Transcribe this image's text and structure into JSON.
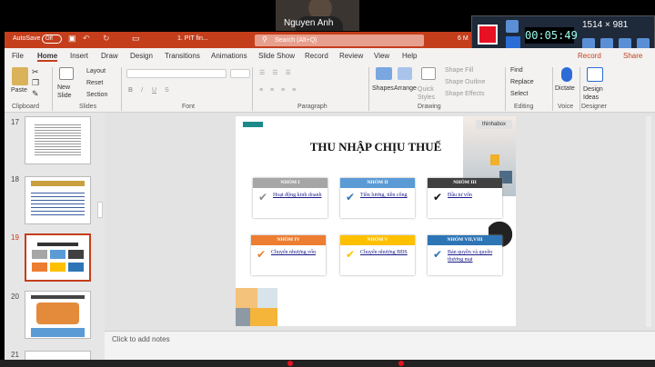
{
  "meeting": {
    "participant_name": "Nguyen Anh"
  },
  "recorder": {
    "timer": "00:05:49",
    "resolution": "1514 × 981"
  },
  "window": {
    "autosave_label": "AutoSave",
    "autosave_state": "Off",
    "file_name": "1. PIT fin...",
    "search_placeholder": "Search (Alt+Q)",
    "right_partial": "6 M"
  },
  "ribbon_tabs": [
    "File",
    "Home",
    "Insert",
    "Draw",
    "Design",
    "Transitions",
    "Animations",
    "Slide Show",
    "Record",
    "Review",
    "View",
    "Help"
  ],
  "ribbon_actions": {
    "record": "Record",
    "share": "Share"
  },
  "ribbon": {
    "clipboard": {
      "paste": "Paste",
      "label": "Clipboard"
    },
    "slides": {
      "new_slide": "New Slide",
      "layout": "Layout",
      "reset": "Reset",
      "section": "Section",
      "label": "Slides"
    },
    "font": {
      "label": "Font"
    },
    "paragraph": {
      "label": "Paragraph"
    },
    "drawing": {
      "shapes": "Shapes",
      "arrange": "Arrange",
      "quick_styles": "Quick Styles",
      "fill": "Shape Fill",
      "outline": "Shape Outline",
      "effects": "Shape Effects",
      "label": "Drawing"
    },
    "editing": {
      "find": "Find",
      "replace": "Replace",
      "select": "Select",
      "label": "Editing"
    },
    "voice": {
      "dictate": "Dictate",
      "label": "Voice"
    },
    "designer": {
      "design_ideas": "Design Ideas",
      "label": "Designer"
    }
  },
  "thumbnails": [
    {
      "num": "17"
    },
    {
      "num": "18"
    },
    {
      "num": "19"
    },
    {
      "num": "20"
    },
    {
      "num": "21"
    }
  ],
  "slide": {
    "title": "THU NHẬP CHỊU THUẾ",
    "badge": "thinhabox",
    "groups": [
      {
        "header": "NHÓM I",
        "text": "Hoạt động kinh doanh",
        "color": "#a6a6a6",
        "check": "#8c8c8c"
      },
      {
        "header": "NHÓM II",
        "text": "Tiền lương, tiền công",
        "color": "#5b9bd5",
        "check": "#2f75b5"
      },
      {
        "header": "NHÓM III",
        "text": "Đầu tư vốn",
        "color": "#404040",
        "check": "#111111"
      },
      {
        "header": "NHÓM IV",
        "text": "Chuyển nhượng vốn",
        "color": "#ed7d31",
        "check": "#ed7d31"
      },
      {
        "header": "NHÓM V",
        "text": "Chuyển nhượng BĐS",
        "color": "#ffc000",
        "check": "#ffc000"
      },
      {
        "header": "NHÓM VII,VIII",
        "text": "Bản quyền và quyền thương mại",
        "color": "#2e75b6",
        "check": "#2e75b6"
      }
    ]
  },
  "notes": {
    "placeholder": "Click to add notes"
  }
}
